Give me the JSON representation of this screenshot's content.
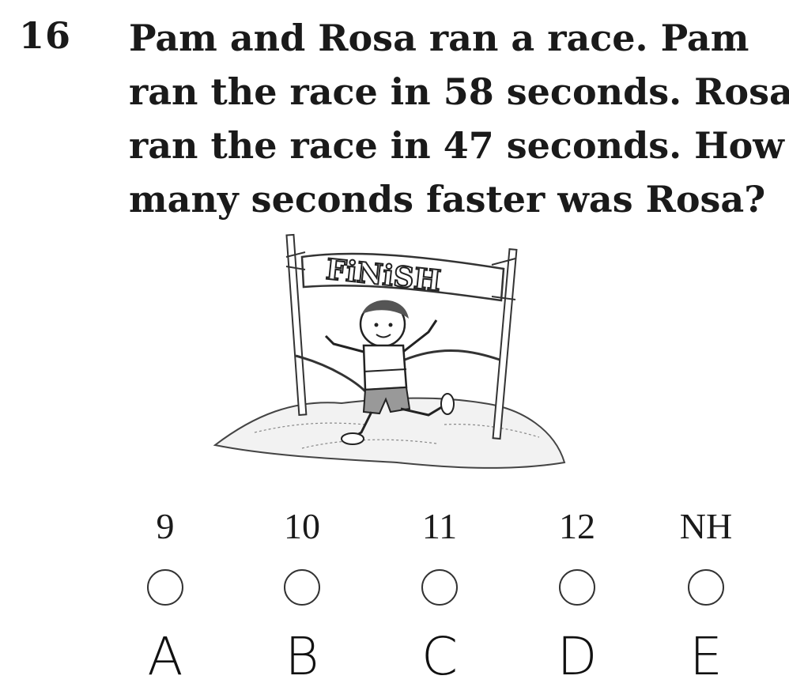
{
  "question": {
    "number": "16",
    "lines": [
      "Pam and Rosa ran a race. Pam",
      "ran the race in 58 seconds. Rosa",
      "ran the race in 47 seconds. How",
      "many seconds faster was Rosa?"
    ]
  },
  "illustration": {
    "banner_text": "FiNiSH"
  },
  "choices": [
    {
      "value": "9",
      "letter": "A"
    },
    {
      "value": "10",
      "letter": "B"
    },
    {
      "value": "11",
      "letter": "C"
    },
    {
      "value": "12",
      "letter": "D"
    },
    {
      "value": "NH",
      "letter": "E"
    }
  ]
}
